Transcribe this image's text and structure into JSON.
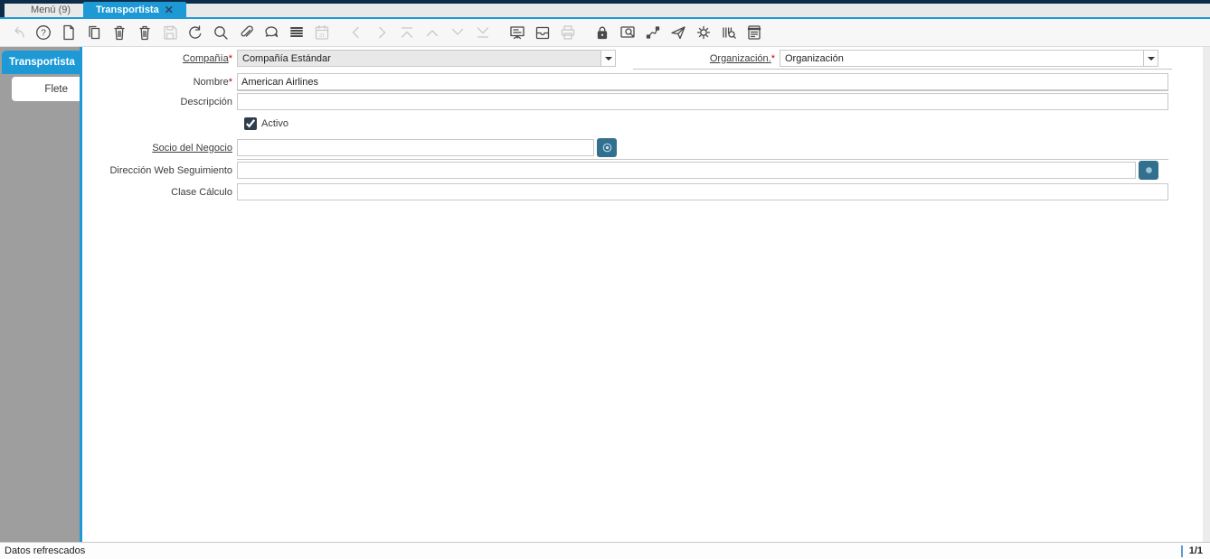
{
  "colors": {
    "accent": "#1d9ad6",
    "dark_header": "#0d2c49",
    "field_button_blue": "#31708f"
  },
  "tabbar": {
    "menu_tab": "Menú (9)",
    "active_tab": "Transportista",
    "close_glyph": "✕"
  },
  "toolbar": {
    "items": [
      {
        "name": "undo",
        "disabled": true
      },
      {
        "name": "help",
        "disabled": false
      },
      {
        "name": "new-record",
        "disabled": false
      },
      {
        "name": "copy-record",
        "disabled": false
      },
      {
        "name": "delete-record",
        "disabled": false
      },
      {
        "name": "delete-selection",
        "disabled": false
      },
      {
        "name": "save",
        "disabled": true
      },
      {
        "name": "refresh",
        "disabled": false
      },
      {
        "name": "find",
        "disabled": false
      },
      {
        "name": "attachment",
        "disabled": false
      },
      {
        "name": "chat",
        "disabled": false
      },
      {
        "name": "toggle-grid",
        "disabled": false
      },
      {
        "name": "calendar",
        "disabled": true
      },
      {
        "name": "previous-record",
        "disabled": true,
        "group": true
      },
      {
        "name": "next-record",
        "disabled": true
      },
      {
        "name": "first-record",
        "disabled": true
      },
      {
        "name": "parent-record",
        "disabled": true
      },
      {
        "name": "detail-record",
        "disabled": true
      },
      {
        "name": "last-record",
        "disabled": true
      },
      {
        "name": "report",
        "disabled": false,
        "group": true
      },
      {
        "name": "archive",
        "disabled": false
      },
      {
        "name": "print",
        "disabled": true
      },
      {
        "name": "lock",
        "disabled": false,
        "group": true
      },
      {
        "name": "zoom-across",
        "disabled": false
      },
      {
        "name": "workflow",
        "disabled": false
      },
      {
        "name": "request",
        "disabled": false
      },
      {
        "name": "process",
        "disabled": false
      },
      {
        "name": "product-info",
        "disabled": false
      },
      {
        "name": "report-view",
        "disabled": false
      }
    ]
  },
  "sidebar": {
    "header": "Transportista",
    "tab": "Flete"
  },
  "form": {
    "fields": {
      "compania": {
        "label": "Compañía",
        "required_marker": "*",
        "value": "Compañía Estándar"
      },
      "organizacion": {
        "label": "Organización.",
        "required_marker": "*",
        "value": "Organización"
      },
      "nombre": {
        "label": "Nombre",
        "required_marker": "*",
        "value": "American Airlines"
      },
      "descripcion": {
        "label": "Descripción",
        "value": ""
      },
      "activo": {
        "label": "Activo",
        "checked": true
      },
      "socio": {
        "label": "Socio del Negocio",
        "value": ""
      },
      "direccion": {
        "label": "Dirección Web Seguimiento",
        "value": ""
      },
      "clase": {
        "label": "Clase Cálculo",
        "value": ""
      }
    }
  },
  "statusbar": {
    "message": "Datos refrescados",
    "record_indicator": "1/1"
  }
}
